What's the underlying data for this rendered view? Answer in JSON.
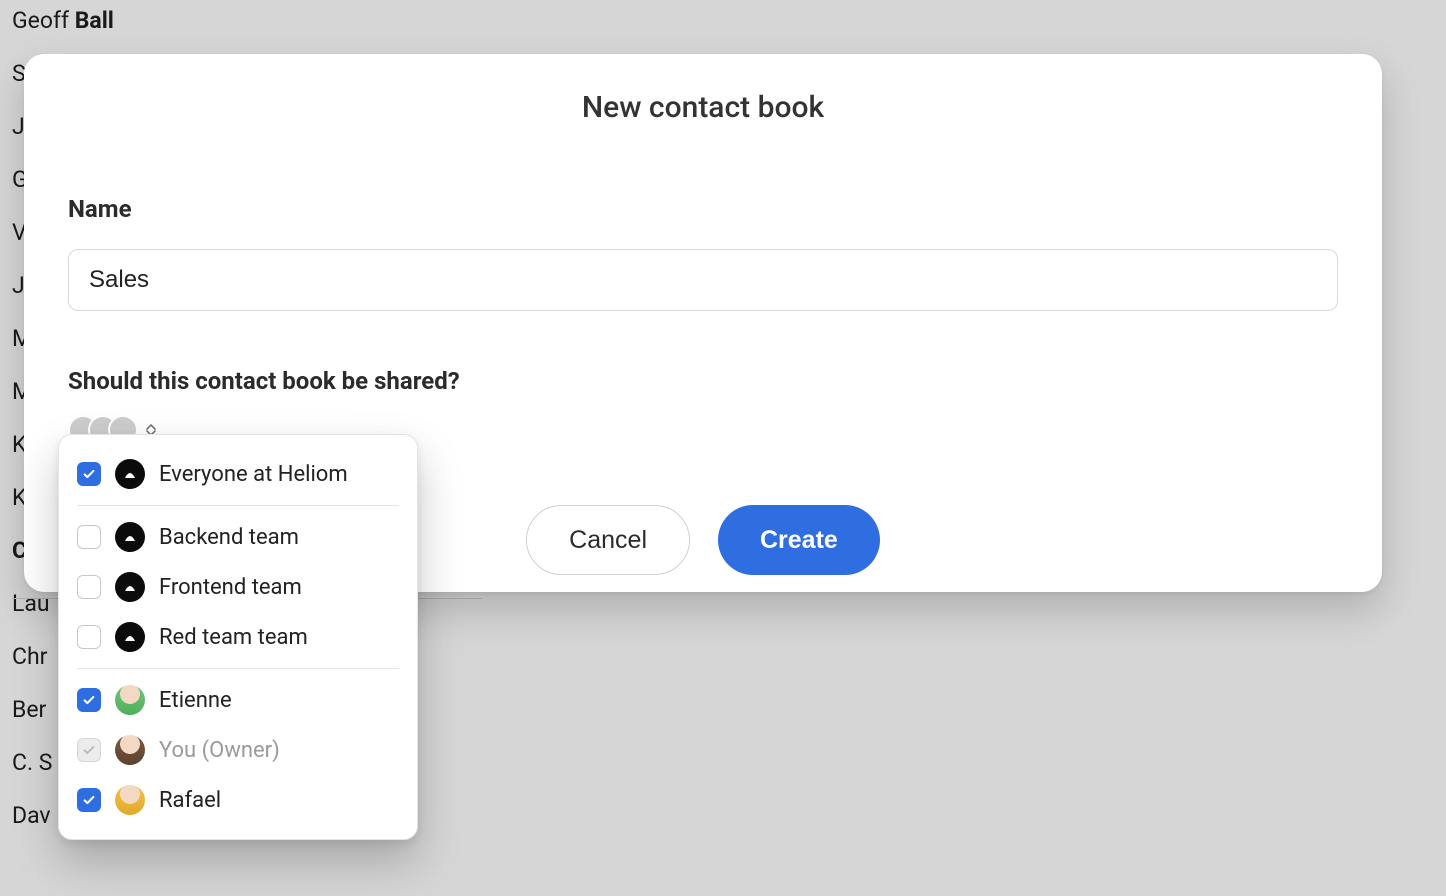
{
  "background_contacts": [
    {
      "first": "Geoff",
      "last": "Ball"
    },
    {
      "first": "S",
      "last": ""
    },
    {
      "first": "J",
      "last": ""
    },
    {
      "first": "G",
      "last": ""
    },
    {
      "first": "V",
      "last": ""
    },
    {
      "first": "J",
      "last": ""
    },
    {
      "first": "M",
      "last": ""
    },
    {
      "first": "M",
      "last": ""
    },
    {
      "first": "K",
      "last": ""
    },
    {
      "first": "K",
      "last": ""
    },
    {
      "first": "C",
      "last": ""
    },
    {
      "first": "Lau",
      "last": ""
    },
    {
      "first": "Chr",
      "last": ""
    },
    {
      "first": "Ber",
      "last": ""
    },
    {
      "first": "C. S",
      "last": ""
    },
    {
      "first": "Dav",
      "last": ""
    }
  ],
  "modal": {
    "title": "New contact book",
    "name_label": "Name",
    "name_value": "Sales",
    "share_label": "Should this contact book be shared?",
    "cancel_label": "Cancel",
    "create_label": "Create"
  },
  "share_dropdown": {
    "groups": [
      {
        "id": "everyone",
        "label": "Everyone at Heliom",
        "type": "team",
        "checked": true
      },
      {
        "id": "backend",
        "label": "Backend team",
        "type": "team",
        "checked": false
      },
      {
        "id": "frontend",
        "label": "Frontend team",
        "type": "team",
        "checked": false
      },
      {
        "id": "redteam",
        "label": "Red team team",
        "type": "team",
        "checked": false
      }
    ],
    "people": [
      {
        "id": "etienne",
        "label": "Etienne",
        "avatar": "av-green",
        "checked": true,
        "disabled": false
      },
      {
        "id": "you",
        "label": "You (Owner)",
        "avatar": "av-brown",
        "checked": true,
        "disabled": true
      },
      {
        "id": "rafael",
        "label": "Rafael",
        "avatar": "av-yellow",
        "checked": true,
        "disabled": false
      }
    ],
    "summary_avatars": [
      "av-green",
      "av-brown",
      "av-yellow"
    ]
  }
}
